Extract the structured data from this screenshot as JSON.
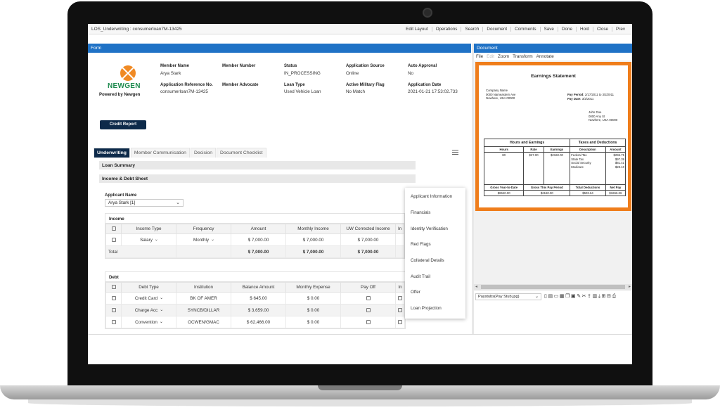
{
  "topbar": {
    "title": "LOS_Underwriting : consumerloan7M-13425",
    "menu": [
      "Edit Layout",
      "Operations",
      "Search",
      "Document",
      "Comments",
      "Save",
      "Done",
      "Hold",
      "Close",
      "Prev"
    ]
  },
  "panels": {
    "form_title": "Form",
    "document_title": "Document"
  },
  "logo": {
    "brand": "NEWGEN",
    "powered_by": "Powered by Newgen"
  },
  "fields": [
    {
      "label": "Member Name",
      "value": "Arya Stark"
    },
    {
      "label": "Member Number",
      "value": ""
    },
    {
      "label": "Status",
      "value": "IN_PROCESSING"
    },
    {
      "label": "Application Source",
      "value": "Online"
    },
    {
      "label": "Auto Approval",
      "value": "No"
    },
    {
      "label": "Application Reference No.",
      "value": "consumerloan7M-13425"
    },
    {
      "label": "Member Advocate",
      "value": ""
    },
    {
      "label": "Loan Type",
      "value": "Used Vehicle Loan"
    },
    {
      "label": "Active Military Flag",
      "value": "No Match"
    },
    {
      "label": "Application Date",
      "value": "2021-01-21 17:53:02.733"
    }
  ],
  "credit_report_label": "Credit Report",
  "tabs": [
    "Underwriting",
    "Member Communication",
    "Decision",
    "Document Checklist"
  ],
  "sections": {
    "loan_summary": "Loan Summary",
    "income_debt": "Income & Debt Sheet"
  },
  "applicant": {
    "label": "Applicant Name",
    "value": "Arya Stark  [1]"
  },
  "income": {
    "caption": "Income",
    "headers": [
      "",
      "Income Type",
      "Frequency",
      "Amount",
      "Monthly Income",
      "UW Corrected Income",
      "In"
    ],
    "rows": [
      {
        "type": "Salary",
        "frequency": "Monthly",
        "amount": "$ 7,000.00",
        "monthly": "$ 7,000.00",
        "corrected": "$ 7,000.00"
      }
    ],
    "total": {
      "label": "Total",
      "amount": "$ 7,000.00",
      "monthly": "$ 7,000.00",
      "corrected": "$ 7,000.00"
    }
  },
  "debt": {
    "caption": "Debt",
    "headers": [
      "",
      "Debt Type",
      "Institution",
      "Balance Amount",
      "Monthly Expense",
      "Pay Off",
      "In"
    ],
    "rows": [
      {
        "type": "Credit Card",
        "institution": "BK OF AMER",
        "balance": "$ 645.00",
        "expense": "$ 0.00"
      },
      {
        "type": "Charge Acc",
        "institution": "SYNCB/DILLAR",
        "balance": "$ 3,659.00",
        "expense": "$ 0.00"
      },
      {
        "type": "Convention",
        "institution": "OCWEN/GMAC",
        "balance": "$ 62,466.00",
        "expense": "$ 0.00"
      }
    ]
  },
  "dropdown_menu": [
    "Applicant Information",
    "Financials",
    "Identity Verification",
    "Red Flags",
    "Collateral Details",
    "Audit Trail",
    "Offer",
    "Loan Projection"
  ],
  "doc_toolbar": [
    "File",
    "Edit",
    "Zoom",
    "Transform",
    "Annotate"
  ],
  "paystub": {
    "title": "Earnings Statement",
    "company": [
      "Company Name",
      "0000 Nameastern Ave",
      "Nowhere, USA 00000"
    ],
    "period_label": "Pay Period:",
    "period_value": "2/17/2011 to 3/2/2011",
    "date_label": "Pay Date:",
    "date_value": "3/2/2011",
    "employee": [
      "John Doe",
      "0000 Any St",
      "Nowhere, USA 00000"
    ],
    "hours_header": "Hours and Earnings",
    "taxes_header": "Taxes and Deductions",
    "cols": [
      "Hours",
      "Rate",
      "Earnings",
      "Description",
      "Amount"
    ],
    "hours": "80",
    "rate": "$27.00",
    "earnings": "$2160.00",
    "deductions": [
      "Federal Tax",
      "State Tax",
      "Social Security",
      "Medicare"
    ],
    "amounts": [
      "$296.75",
      "$97.39",
      "$81.41",
      "$28.10"
    ],
    "ytd_cols": [
      "Gross Year-to-Date",
      "Gross This Pay Period",
      "Total Deductions",
      "Net Pay"
    ],
    "ytd_vals": [
      "$8640.00",
      "$2160.00",
      "$503.64",
      "$1656.36"
    ]
  },
  "doc_select": "Paystubs(Pay Stub.jpg)",
  "doc_icons": [
    "file-icon",
    "save-icon",
    "print-icon",
    "scan-icon",
    "copy-icon",
    "paste-icon",
    "tools-icon",
    "cut-icon",
    "export-icon",
    "stamp-icon",
    "download-icon",
    "cart-icon",
    "cart-add-icon",
    "printer-icon"
  ]
}
